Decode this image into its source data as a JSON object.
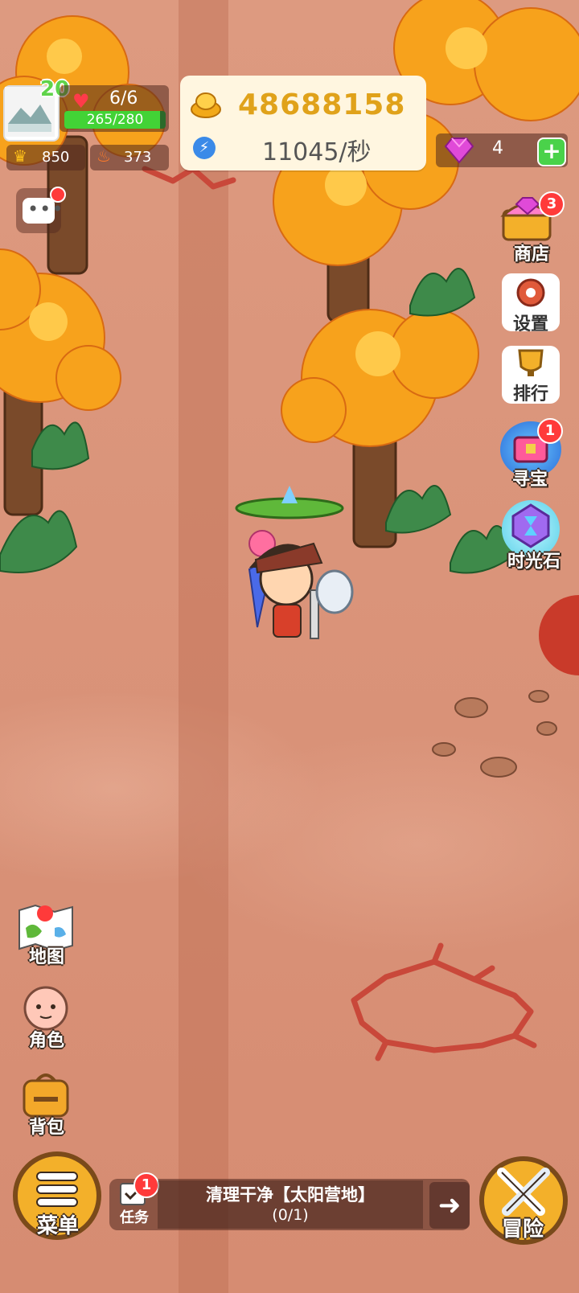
{
  "player": {
    "level": "20",
    "hp": "6/6",
    "xp": "265/280",
    "xp_fraction": 0.946,
    "crowns": "850",
    "power": "373"
  },
  "currency": {
    "gold": "48688158",
    "rate": "11045/秒",
    "gems": "4"
  },
  "chat": {
    "has_notification": true
  },
  "right_menu": {
    "shop": {
      "label": "商店",
      "badge": "3"
    },
    "settings": {
      "label": "设置"
    },
    "ranking": {
      "label": "排行"
    },
    "treasure": {
      "label": "寻宝",
      "badge": "1"
    },
    "timestone": {
      "label": "时光石"
    }
  },
  "left_menu": {
    "map": {
      "label": "地图"
    },
    "character": {
      "label": "角色"
    },
    "backpack": {
      "label": "背包"
    }
  },
  "bottom": {
    "menu_label": "菜单",
    "adventure_label": "冒险",
    "quest": {
      "tab_label": "任务",
      "badge": "1",
      "title": "清理干净【太阳营地】",
      "progress": "(0/1)"
    }
  },
  "colors": {
    "gold_text": "#e0a21a",
    "xp_fill": "#42d336",
    "badge_red": "#ff3a3a"
  }
}
